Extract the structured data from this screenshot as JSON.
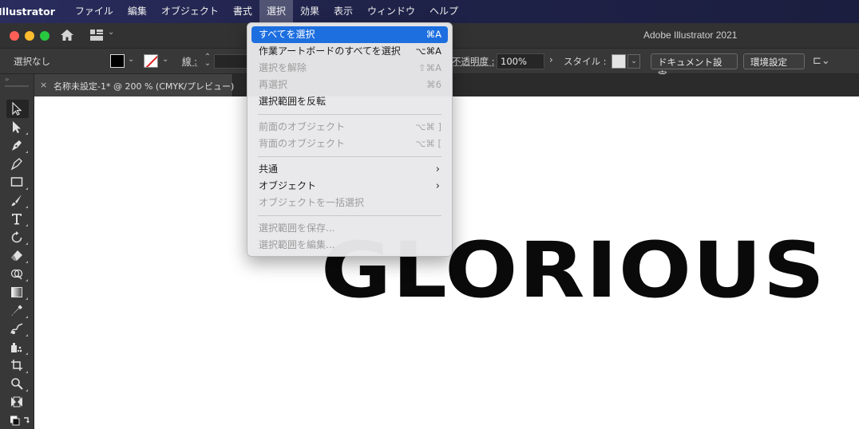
{
  "menubar": {
    "app": "Illustrator",
    "items": [
      "ファイル",
      "編集",
      "オブジェクト",
      "書式",
      "選択",
      "効果",
      "表示",
      "ウィンドウ",
      "ヘルプ"
    ],
    "active_index": 4
  },
  "titlebar": {
    "title": "Adobe Illustrator 2021"
  },
  "controlbar": {
    "selection_status": "選択なし",
    "stroke_label": "線 :",
    "opacity_label": "不透明度 :",
    "opacity_value": "100%",
    "style_label": "スタイル :",
    "document_setup": "ドキュメント設定",
    "preferences": "環境設定"
  },
  "tab": {
    "close": "×",
    "label": "名称未設定-1* @ 200 % (CMYK/プレビュー)"
  },
  "canvas": {
    "text": "GLORIOUS"
  },
  "select_menu": {
    "groups": [
      [
        {
          "label": "すべてを選択",
          "shortcut": "⌘A",
          "enabled": true,
          "highlighted": true
        },
        {
          "label": "作業アートボードのすべてを選択",
          "shortcut": "⌥⌘A",
          "enabled": true
        },
        {
          "label": "選択を解除",
          "shortcut": "⇧⌘A",
          "enabled": false
        },
        {
          "label": "再選択",
          "shortcut": "⌘6",
          "enabled": false
        },
        {
          "label": "選択範囲を反転",
          "shortcut": "",
          "enabled": true
        }
      ],
      [
        {
          "label": "前面のオブジェクト",
          "shortcut": "⌥⌘ ]",
          "enabled": false
        },
        {
          "label": "背面のオブジェクト",
          "shortcut": "⌥⌘ [",
          "enabled": false
        }
      ],
      [
        {
          "label": "共通",
          "shortcut": "",
          "enabled": true,
          "submenu": true
        },
        {
          "label": "オブジェクト",
          "shortcut": "",
          "enabled": true,
          "submenu": true
        },
        {
          "label": "オブジェクトを一括選択",
          "shortcut": "",
          "enabled": false
        }
      ],
      [
        {
          "label": "選択範囲を保存...",
          "shortcut": "",
          "enabled": false
        },
        {
          "label": "選択範囲を編集...",
          "shortcut": "",
          "enabled": false
        }
      ]
    ]
  },
  "colors": {
    "menubar": "#20234a",
    "highlight": "#1d6fe0",
    "panel": "#383838"
  }
}
